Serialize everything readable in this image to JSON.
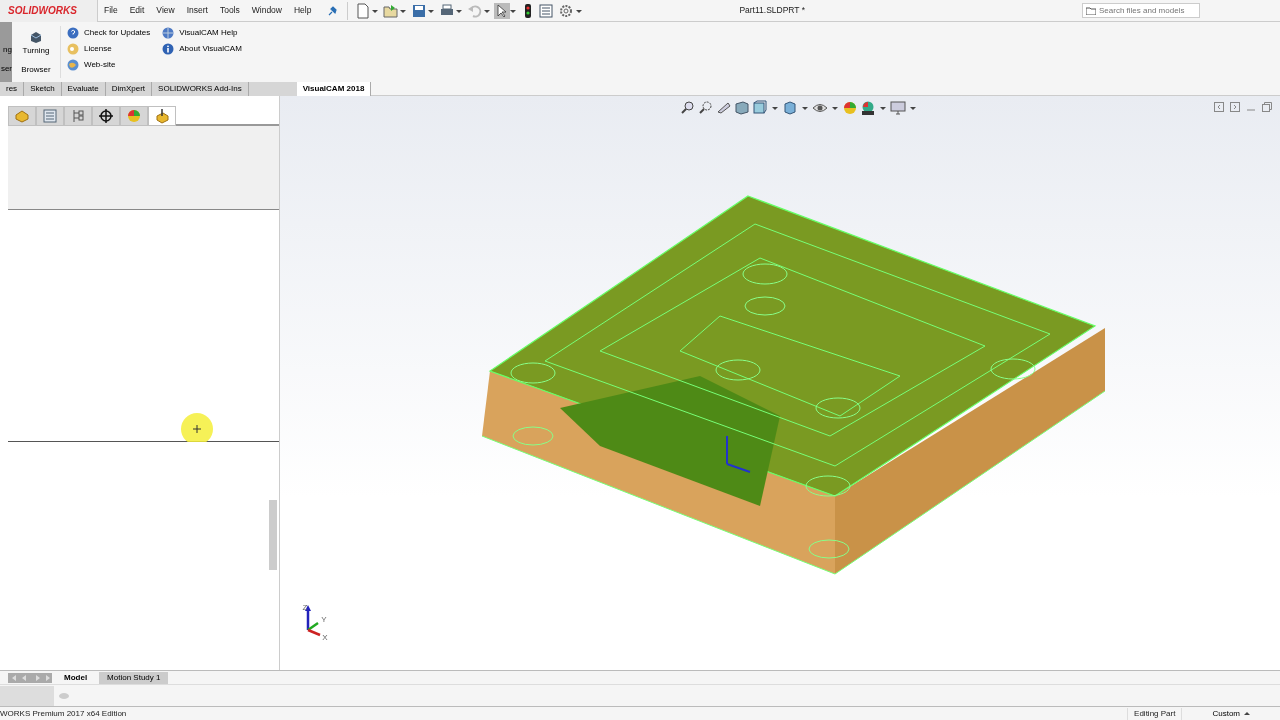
{
  "title_bar": {
    "logo": "SOLIDWORKS",
    "menu": [
      "File",
      "Edit",
      "View",
      "Insert",
      "Tools",
      "Window",
      "Help"
    ],
    "document_title": "Part11.SLDPRT *",
    "search": {
      "placeholder": "Search files and models"
    }
  },
  "ribbon": {
    "big_buttons": [
      {
        "lines": [
          "ng",
          "ser"
        ],
        "selected": true
      },
      {
        "lines": [
          "Turning",
          "Browser"
        ],
        "selected": false
      }
    ],
    "columns": [
      [
        "Check for Updates",
        "License",
        "Web-site"
      ],
      [
        "VisualCAM Help",
        "About VisualCAM"
      ]
    ]
  },
  "command_tabs": [
    {
      "label": "res",
      "selected": false
    },
    {
      "label": "Sketch",
      "selected": false
    },
    {
      "label": "Evaluate",
      "selected": false
    },
    {
      "label": "DimXpert",
      "selected": false
    },
    {
      "label": "SOLIDWORKS Add-Ins",
      "selected": false
    },
    {
      "label": "VisualCAM 2018",
      "selected": true
    }
  ],
  "panel_tabs": [
    {
      "selected": false
    },
    {
      "selected": false
    },
    {
      "selected": false
    },
    {
      "selected": false
    },
    {
      "selected": false
    },
    {
      "selected": true
    }
  ],
  "triad": [
    "Z",
    "Y",
    "X"
  ],
  "bottom_tabs": [
    {
      "label": "Model",
      "selected": true
    },
    {
      "label": "Motion Study 1",
      "selected": false
    }
  ],
  "status_bar": {
    "edition": "WORKS Premium 2017 x64 Edition",
    "mode": "Editing Part",
    "units": "Custom"
  }
}
